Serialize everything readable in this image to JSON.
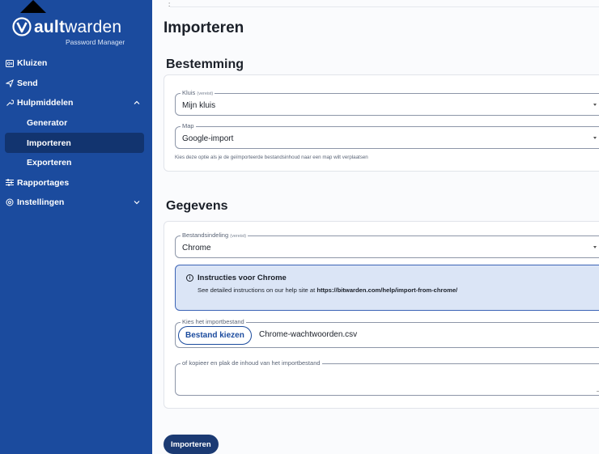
{
  "app": {
    "logo_bold": "ault",
    "logo_light": "warden",
    "logo_subtitle": "Password Manager"
  },
  "sidebar": {
    "items": [
      {
        "label": "Kluizen",
        "icon": "vault-icon"
      },
      {
        "label": "Send",
        "icon": "send-icon"
      },
      {
        "label": "Hulpmiddelen",
        "icon": "wrench-icon",
        "expanded": true
      },
      {
        "label": "Generator"
      },
      {
        "label": "Importeren",
        "active": true
      },
      {
        "label": "Exporteren"
      },
      {
        "label": "Rapportages",
        "icon": "sliders-icon"
      },
      {
        "label": "Instellingen",
        "icon": "gear-icon",
        "expanded": false
      }
    ]
  },
  "page": {
    "title": "Importeren",
    "submit_label": "Importeren"
  },
  "destination": {
    "title": "Bestemming",
    "vault_label": "Kluis",
    "vault_required": "(vereist)",
    "vault_value": "Mijn kluis",
    "folder_label": "Map",
    "folder_value": "Google-import",
    "folder_help": "Kies deze optie als je de geïmporteerde bestandsinhoud naar een map wilt verplaatsen"
  },
  "data_section": {
    "title": "Gegevens",
    "format_label": "Bestandsindeling",
    "format_required": "(vereist)",
    "format_value": "Chrome",
    "info_title": "Instructies voor Chrome",
    "info_text": "See detailed instructions on our help site at",
    "info_link": "https://bitwarden.com/help/import-from-chrome/",
    "file_label": "Kies het importbestand",
    "file_button": "Bestand kiezen",
    "file_name": "Chrome-wachtwoorden.csv",
    "paste_label": "of kopieer en plak de inhoud van het importbestand",
    "paste_value": ""
  },
  "colors": {
    "sidebar_bg": "#1b4b9e",
    "sidebar_active": "#12346f",
    "info_bg": "#dbe5f6",
    "primary_button": "#1b3a73"
  }
}
